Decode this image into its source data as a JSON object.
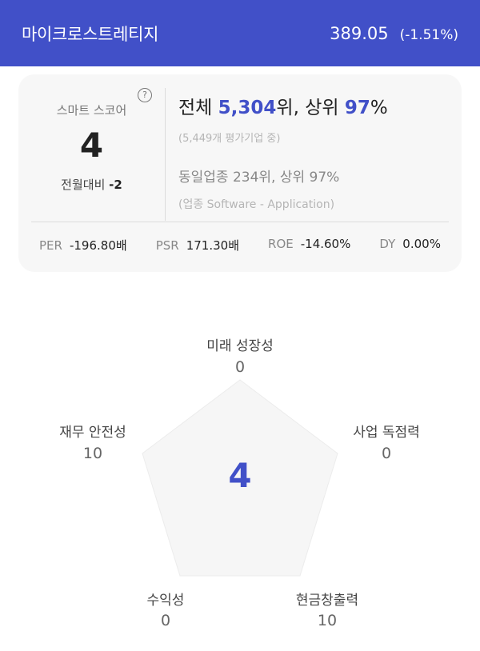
{
  "header": {
    "title": "마이크로스트레티지",
    "price": "389.05",
    "change": "(-1.51%)"
  },
  "score": {
    "label": "스마트 스코어",
    "help_icon": "?",
    "value": "4",
    "delta_label": "전월대비",
    "delta_value": "-2"
  },
  "rank": {
    "prefix": "전체",
    "overall_rank": "5,304",
    "rank_unit": "위, 상위",
    "overall_pct": "97",
    "pct_unit": "%",
    "sub": "(5,449개 평가기업 중)",
    "industry": "동일업종 234위, 상위 97%",
    "industry_sub": "(업종 Software - Application)"
  },
  "metrics": [
    {
      "key": "PER",
      "value": "-196.80배"
    },
    {
      "key": "PSR",
      "value": "171.30배"
    },
    {
      "key": "ROE",
      "value": "-14.60%"
    },
    {
      "key": "DY",
      "value": "0.00%"
    }
  ],
  "radar": {
    "center_value": "4",
    "axes": [
      {
        "label": "미래 성장성",
        "value": "0"
      },
      {
        "label": "사업 독점력",
        "value": "0"
      },
      {
        "label": "현금창출력",
        "value": "10"
      },
      {
        "label": "수익성",
        "value": "0"
      },
      {
        "label": "재무 안전성",
        "value": "10"
      }
    ]
  },
  "colors": {
    "brand": "#4150c8",
    "card_bg": "#f7f7f7",
    "pentagon_fill": "#f6f6f6"
  }
}
